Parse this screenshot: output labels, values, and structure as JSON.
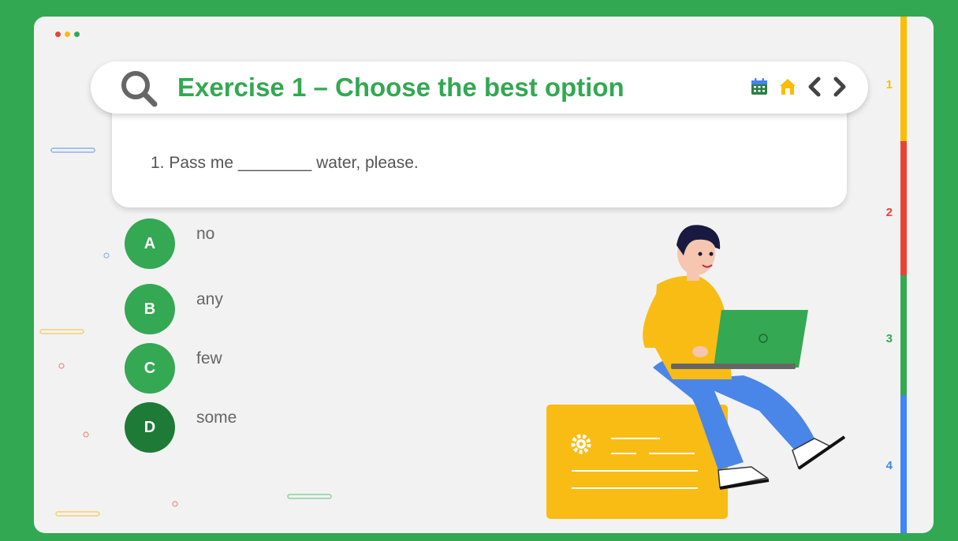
{
  "window": {
    "traffic_lights": [
      "#ea4335",
      "#fbbc04",
      "#34a853"
    ]
  },
  "header": {
    "title": "Exercise 1 – Choose the best option",
    "icons": [
      "search-icon",
      "calendar-icon",
      "home-icon",
      "chevron-left-icon",
      "chevron-right-icon"
    ]
  },
  "question": {
    "text": "1. Pass me ________ water, please."
  },
  "options": [
    {
      "letter": "A",
      "text": "no",
      "color": "#34a853"
    },
    {
      "letter": "B",
      "text": "any",
      "color": "#34a853"
    },
    {
      "letter": "C",
      "text": "few",
      "color": "#34a853"
    },
    {
      "letter": "D",
      "text": "some",
      "color": "#1e7a37"
    }
  ],
  "progress_sidebar": {
    "steps": [
      {
        "label": "1",
        "color": "#fbbc04"
      },
      {
        "label": "2",
        "color": "#ea4335"
      },
      {
        "label": "3",
        "color": "#34a853"
      },
      {
        "label": "4",
        "color": "#4285f4"
      }
    ]
  },
  "colors": {
    "background": "#33a852",
    "accent": "#33a852",
    "selected": "#1e7a37"
  }
}
